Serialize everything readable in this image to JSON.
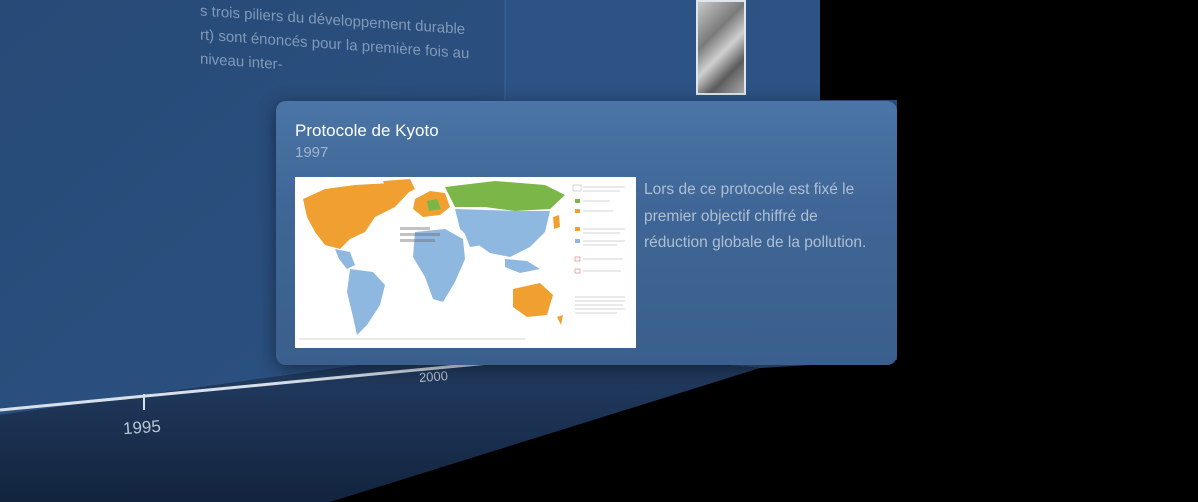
{
  "background": {
    "text_lines": [
      "s trois piliers du développement durable",
      "rt) sont énoncés pour la première fois au niveau inter-",
      "-"
    ],
    "timeline_years": [
      "1995",
      "2000"
    ]
  },
  "card": {
    "title": "Protocole de Kyoto",
    "year": "1997",
    "description": "Lors de ce protocole est fixé le premier objectif chiffré de réduction globale de la pollution.",
    "map_icon": "world-map-image"
  },
  "colors": {
    "card_bg": "#4374a5",
    "map_green": "#7ab648",
    "map_orange": "#f0a030",
    "map_blue": "#8fb8e0",
    "background": "#2b4c78"
  }
}
